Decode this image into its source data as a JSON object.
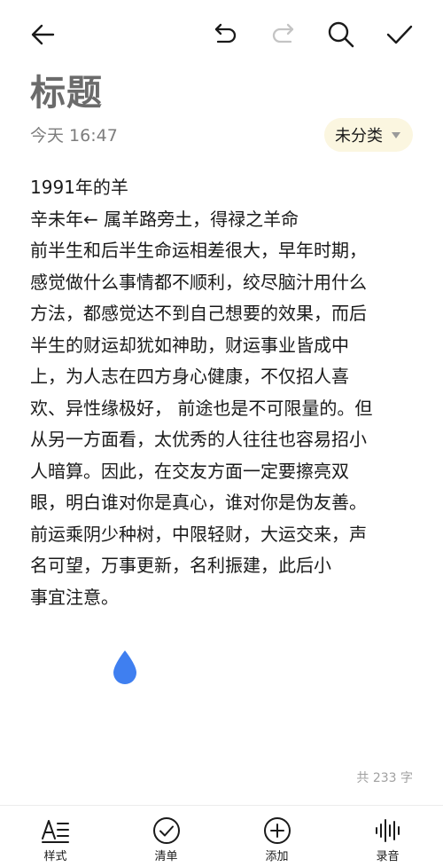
{
  "toolbar": {
    "back_icon": "arrow-left-icon",
    "undo_icon": "undo-icon",
    "redo_icon": "redo-icon",
    "search_icon": "search-icon",
    "confirm_icon": "check-icon"
  },
  "note": {
    "title": "标题",
    "timestamp": "今天 16:47",
    "category": "未分类",
    "lines": [
      "1991年的羊",
      "辛未年← 属羊路旁土，得禄之羊命",
      "前半生和后半生命运相差很大，早年时期，",
      "感觉做什么事情都不顺利，绞尽脑汁用什么",
      "方法，都感觉达不到自己想要的效果，而后",
      "半生的财运却犹如神助，财运事业皆成中",
      "上，为人志在四方身心健康，不仅招人喜",
      "欢、异性缘极好， 前途也是不可限量的。但",
      "从另一方面看，太优秀的人往往也容易招小",
      "人暗算。因此，在交友方面一定要擦亮双",
      "眼，明白谁对你是真心，谁对你是伪友善。",
      "前运乘阴少种树，中限轻财，大运交来，声",
      "名可望，万事更新，名利振建，此后小",
      "事宜注意。"
    ],
    "word_count": "共 233 字"
  },
  "bottom_bar": {
    "items": [
      {
        "label": "样式",
        "icon": "text-style-icon"
      },
      {
        "label": "清单",
        "icon": "checklist-icon"
      },
      {
        "label": "添加",
        "icon": "add-circle-icon"
      },
      {
        "label": "录音",
        "icon": "audio-wave-icon"
      }
    ]
  },
  "colors": {
    "cursor_handle": "#3f7ff0",
    "category_chip_bg": "#fbf6e0",
    "title": "#6b6b6b",
    "disabled_icon": "#c4c4c4"
  }
}
